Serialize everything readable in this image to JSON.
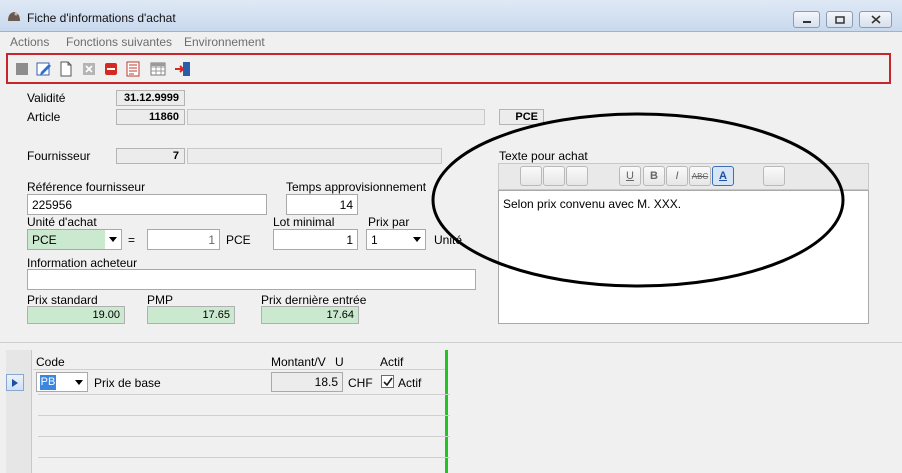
{
  "window": {
    "title": "Fiche d'informations d'achat"
  },
  "menu": {
    "items": [
      "Actions",
      "Fonctions suivantes",
      "Environnement"
    ]
  },
  "toolbar": {
    "buttons": [
      "save-icon",
      "edit-icon",
      "new-document-icon",
      "delete-icon",
      "stop-icon",
      "print-list-icon",
      "table-icon",
      "exit-icon"
    ]
  },
  "form": {
    "validite": {
      "label": "Validité",
      "value": "31.12.9999"
    },
    "article": {
      "label": "Article",
      "value": "11860",
      "unit": "PCE"
    },
    "fournisseur": {
      "label": "Fournisseur",
      "value": "7"
    },
    "ref_fournisseur": {
      "label": "Référence fournisseur",
      "value": "225956"
    },
    "temps_appro": {
      "label": "Temps approvisionnement",
      "value": "14"
    },
    "unite_achat": {
      "label": "Unité d'achat",
      "value": "PCE",
      "equals": "=",
      "factor": "1",
      "factor_unit": "PCE"
    },
    "lot_minimal": {
      "label": "Lot minimal",
      "value": "1"
    },
    "prix_par": {
      "label": "Prix par",
      "value": "1",
      "unit": "Unité"
    },
    "info_acheteur": {
      "label": "Information acheteur",
      "value": ""
    },
    "prix_standard": {
      "label": "Prix standard",
      "value": "19.00"
    },
    "pmp": {
      "label": "PMP",
      "value": "17.65"
    },
    "prix_derniere": {
      "label": "Prix dernière entrée",
      "value": "17.64"
    }
  },
  "texte_achat": {
    "label": "Texte pour achat",
    "content": "Selon prix convenu avec M. XXX.",
    "format_buttons": [
      "U",
      "B",
      "I",
      "ABC",
      "A"
    ]
  },
  "grid": {
    "headers": {
      "code": "Code",
      "montant": "Montant/V",
      "unit": "U",
      "actif": "Actif"
    },
    "rows": [
      {
        "code": "PB",
        "description": "Prix de base",
        "montant": "18.5",
        "currency": "CHF",
        "actif_label": "Actif",
        "checked": true
      }
    ]
  }
}
